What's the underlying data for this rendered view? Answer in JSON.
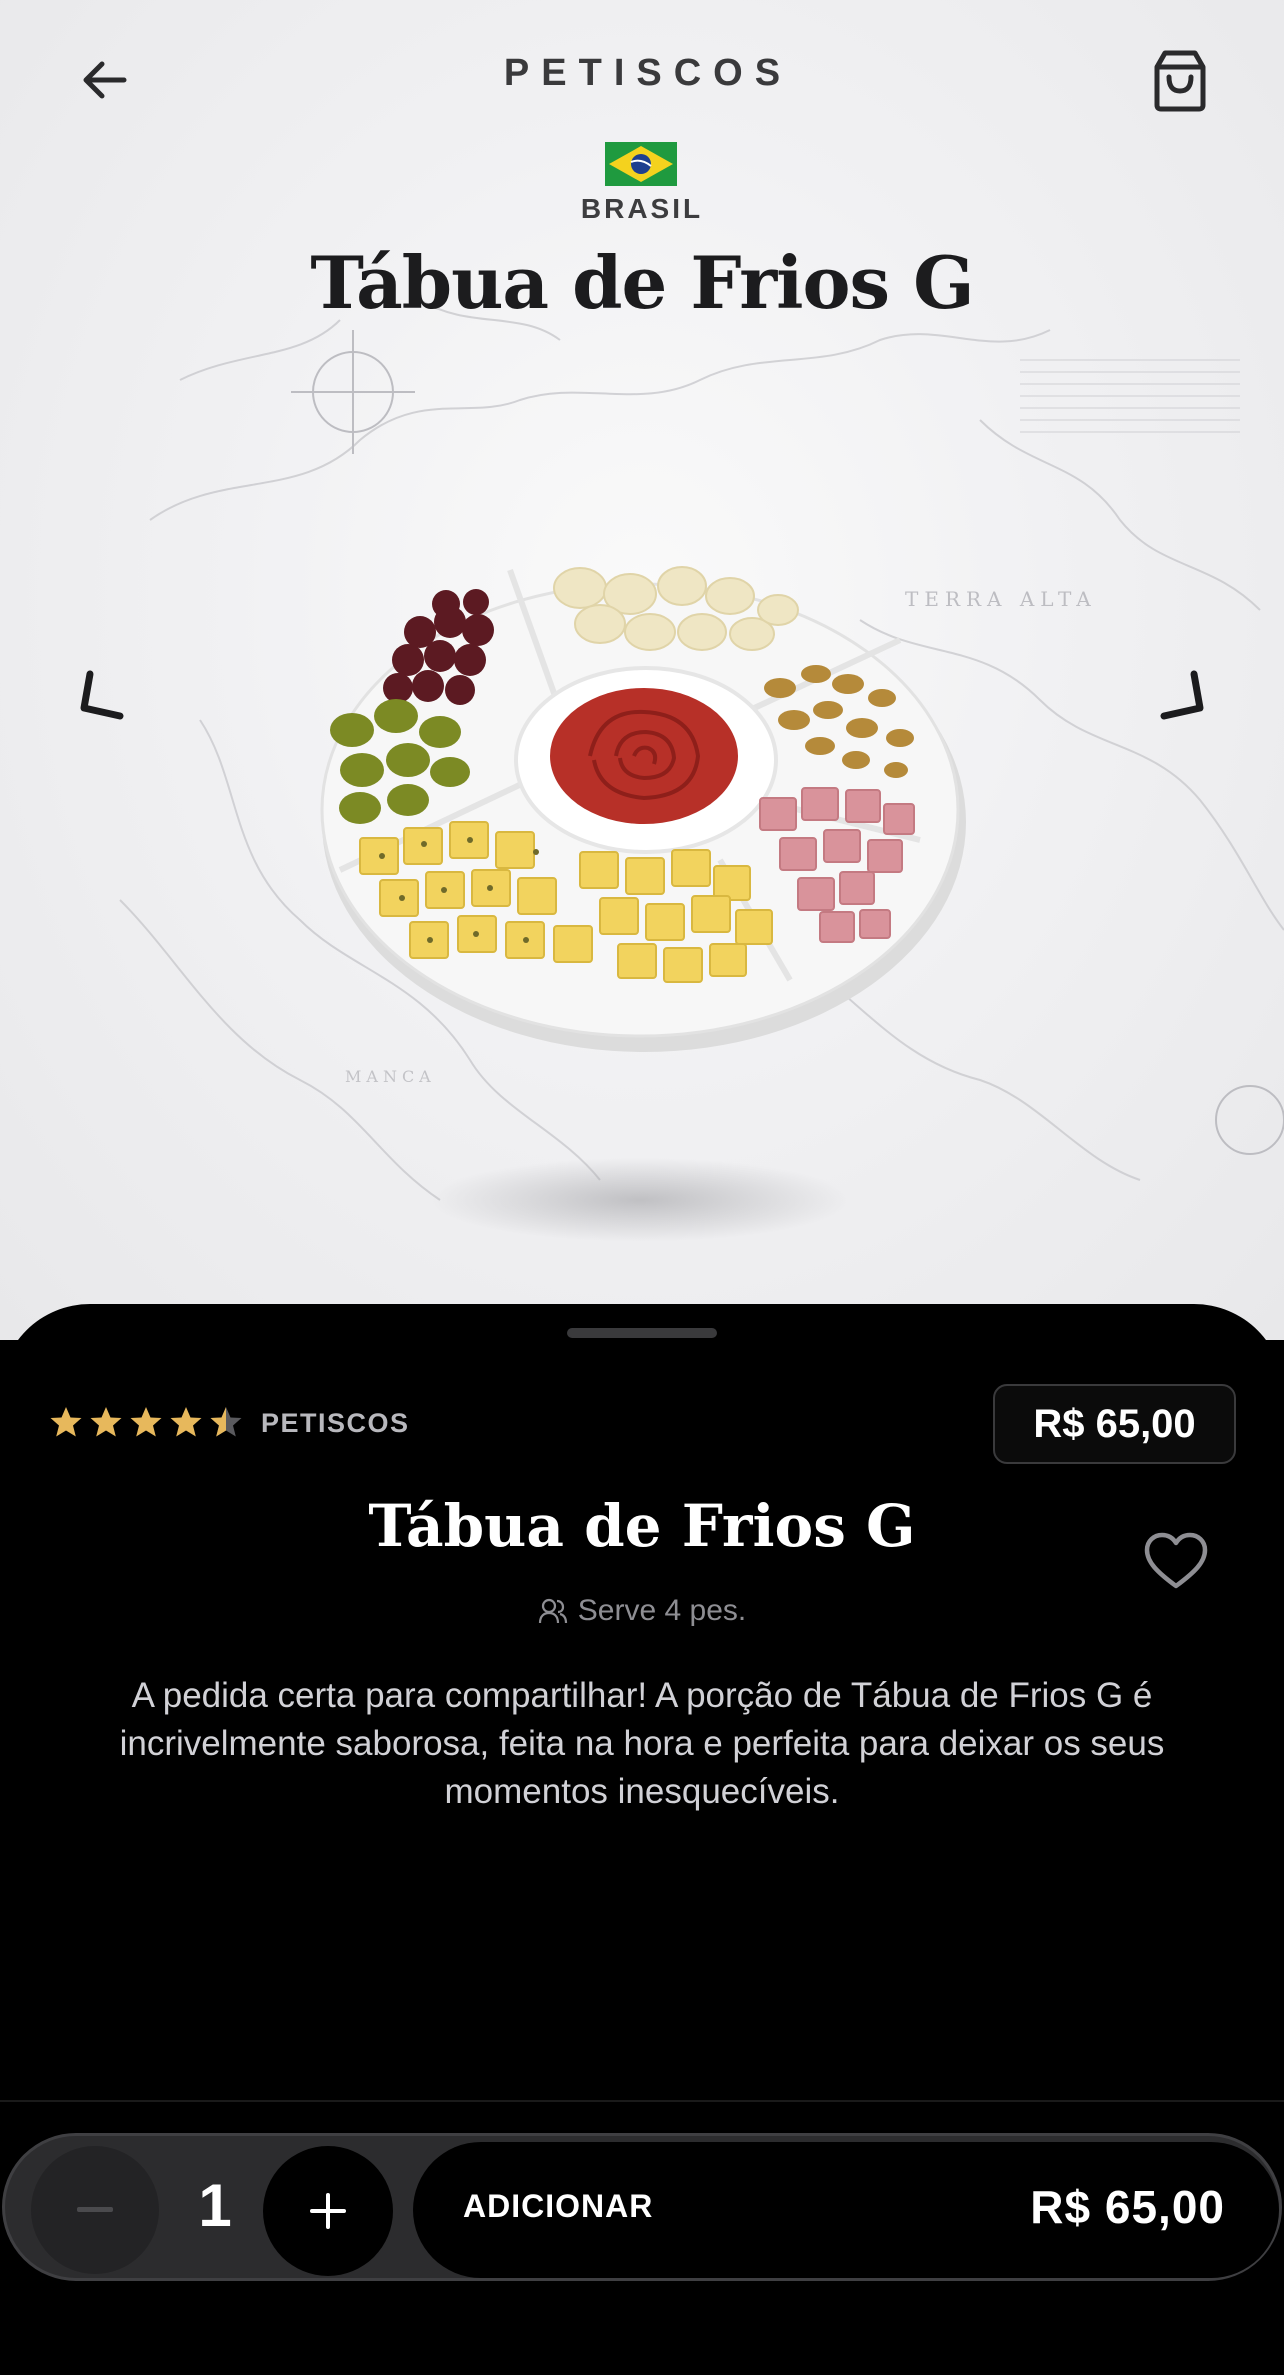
{
  "header": {
    "category_title": "PETISCOS",
    "back_icon": "arrow-left-icon",
    "cart_icon": "shopping-bag-icon"
  },
  "hero": {
    "country": "BRASIL",
    "flag_icon": "brazil-flag-icon",
    "title": "Tábua de Frios G",
    "prev_icon": "chevron-corner-left-icon",
    "next_icon": "chevron-corner-right-icon",
    "image": "charcuterie-platter-image"
  },
  "product": {
    "rating": 4.5,
    "rating_max": 5,
    "category": "PETISCOS",
    "price": "R$ 65,00",
    "title": "Tábua de Frios G",
    "serves": "Serve 4 pes.",
    "description": "A pedida certa para compartilhar! A porção de Tábua de Frios G é incrivelmente saborosa, feita na hora e perfeita para deixar os seus momentos inesquecíveis."
  },
  "cart_bar": {
    "quantity": "1",
    "minus_icon": "minus-icon",
    "plus_icon": "plus-icon",
    "add_label": "ADICIONAR",
    "total": "R$ 65,00"
  },
  "colors": {
    "star": "#e7b85c",
    "sheet_bg": "#000000",
    "hero_bg": "#eeeef0",
    "text_secondary": "#8e8e93"
  }
}
